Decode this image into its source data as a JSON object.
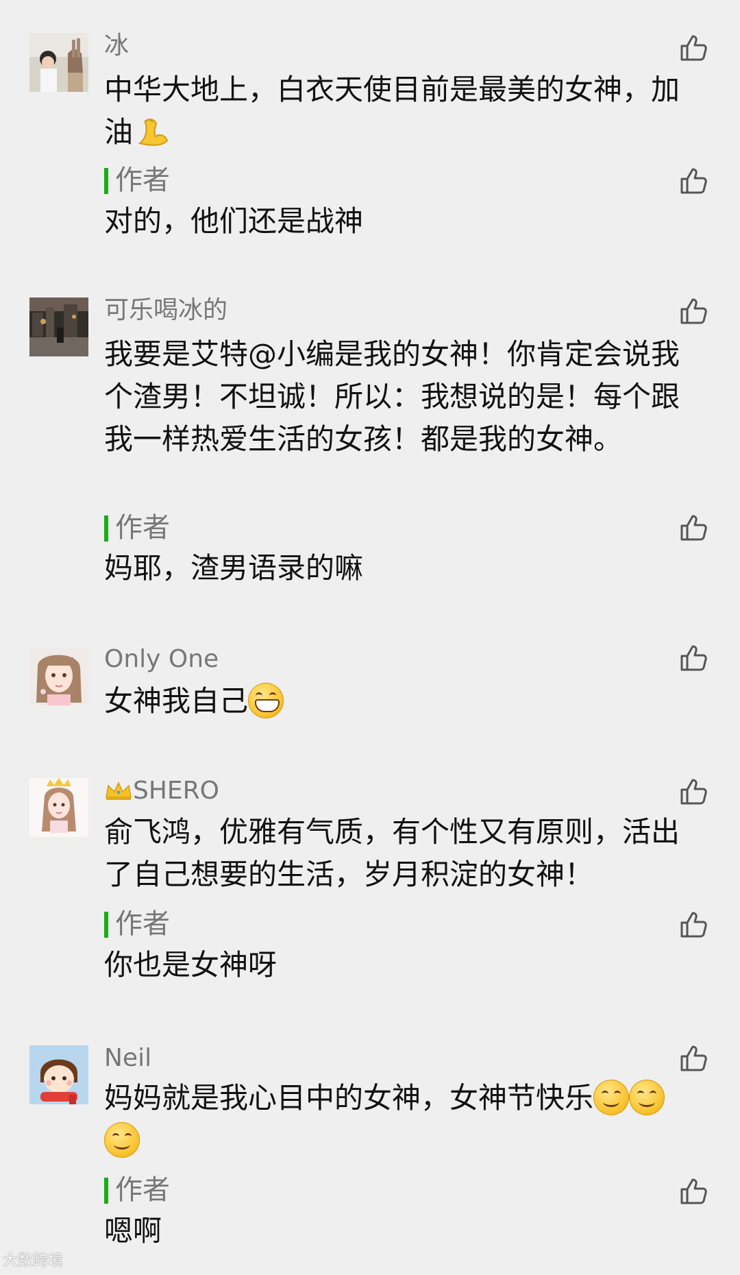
{
  "comments": [
    {
      "nickname": "冰",
      "content": "中华大地上，白衣天使目前是最美的女神，加油",
      "content_emoji": "flexed-biceps-emoji",
      "reply": {
        "label": "作者",
        "text": "对的，他们还是战神"
      }
    },
    {
      "nickname": "可乐喝冰的",
      "content": "我要是艾特@小编是我的女神！你肯定会说我个渣男！不坦诚！所以：我想说的是！每个跟我一样热爱生活的女孩！都是我的女神。",
      "reply": {
        "label": "作者",
        "text": "妈耶，渣男语录的嘛"
      }
    },
    {
      "nickname": "Only One",
      "content": "女神我自己",
      "content_emoji": "grinning-face-emoji"
    },
    {
      "nickname_icon": "crown-icon",
      "nickname": "SHERO",
      "content": "俞飞鸿，优雅有气质，有个性又有原则，活出了自己想要的生活，岁月积淀的女神！",
      "reply": {
        "label": "作者",
        "text": "你也是女神呀"
      }
    },
    {
      "nickname": "Neil",
      "content": "妈妈就是我心目中的女神，女神节快乐",
      "content_emoji": "smiling-face-emoji",
      "reply": {
        "label": "作者",
        "text": "嗯啊"
      }
    }
  ],
  "watermark": "大数跨境",
  "icons": {
    "like": "thumbs-up-icon"
  },
  "colors": {
    "background": "#efefef",
    "reply_bar": "#19ad19",
    "nickname": "#777777",
    "text": "#111111"
  }
}
